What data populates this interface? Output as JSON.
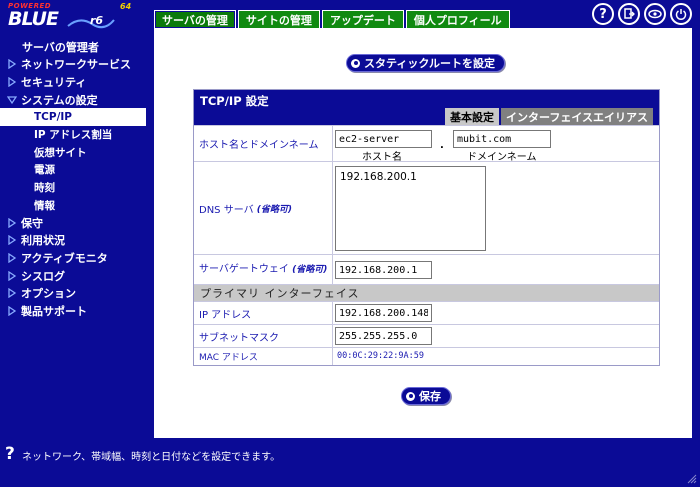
{
  "logo": {
    "powered": "POWERED",
    "brand": "BLUE",
    "version": "r6",
    "bits": "64"
  },
  "top_tabs": [
    {
      "label": "サーバの管理",
      "active": true
    },
    {
      "label": "サイトの管理",
      "active": false
    },
    {
      "label": "アップデート",
      "active": false
    },
    {
      "label": "個人プロフィール",
      "active": false
    }
  ],
  "top_icons": [
    "help-icon",
    "logout-icon",
    "eye-icon",
    "power-icon"
  ],
  "sidebar": {
    "header": "サーバの管理者",
    "items": [
      {
        "label": "ネットワークサービス"
      },
      {
        "label": "セキュリティ"
      },
      {
        "label": "システムの設定",
        "expanded": true
      },
      {
        "label": "保守"
      },
      {
        "label": "利用状況"
      },
      {
        "label": "アクティブモニタ"
      },
      {
        "label": "シスログ"
      },
      {
        "label": "オプション"
      },
      {
        "label": "製品サポート"
      }
    ],
    "subitems": [
      {
        "label": "TCP/IP",
        "active": true
      },
      {
        "label": "IP アドレス割当"
      },
      {
        "label": "仮想サイト"
      },
      {
        "label": "電源"
      },
      {
        "label": "時刻"
      },
      {
        "label": "情報"
      }
    ]
  },
  "main": {
    "static_route_button": "スタティックルートを設定",
    "panel_title": "TCP/IP 設定",
    "subtabs": [
      "基本設定",
      "インターフェイスエイリアス"
    ],
    "host_label": "ホスト名とドメインネーム",
    "host_value": "ec2-server",
    "host_caption": "ホスト名",
    "domain_value": "mubit.com",
    "domain_caption": "ドメインネーム",
    "dot_separator": ".",
    "dns_label": "DNS サーバ",
    "dns_optional": "(省略可)",
    "dns_value": "192.168.200.1",
    "gateway_label": "サーバゲートウェイ",
    "gateway_optional": "(省略可)",
    "gateway_value": "192.168.200.1",
    "primary_section": "プライマリ インターフェイス",
    "ip_label": "IP アドレス",
    "ip_value": "192.168.200.148",
    "mask_label": "サブネットマスク",
    "mask_value": "255.255.255.0",
    "mac_label": "MAC アドレス",
    "mac_value": "00:0C:29:22:9A:59",
    "save_button": "保存"
  },
  "status": {
    "text": "ネットワーク、帯域幅、時刻と日付などを設定できます。"
  },
  "colors": {
    "navy": "#0b0b96",
    "tab_green": "#0a7a0a",
    "label_blue": "#1a1ab0"
  }
}
